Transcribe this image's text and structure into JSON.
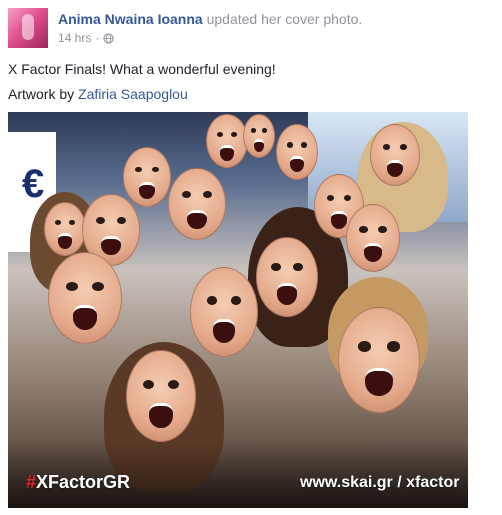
{
  "post": {
    "author": "Anima Nwaina Ioanna",
    "action": " updated her cover photo.",
    "timestamp": "14 hrs",
    "separator": "·",
    "privacy_icon": "globe-icon",
    "caption": "X Factor Finals! What a wonderful evening!",
    "credit_prefix": "Artwork by ",
    "credit_name": "Zafiria Saapoglou"
  },
  "photo": {
    "tag_hash": "#",
    "tag_text": "XFactorGR",
    "url": "www.skai.gr / xfactor",
    "stage_letter": "€"
  },
  "colors": {
    "link": "#365899",
    "muted": "#90949c",
    "text": "#1d2129",
    "hashtag_red": "#e8232a"
  }
}
